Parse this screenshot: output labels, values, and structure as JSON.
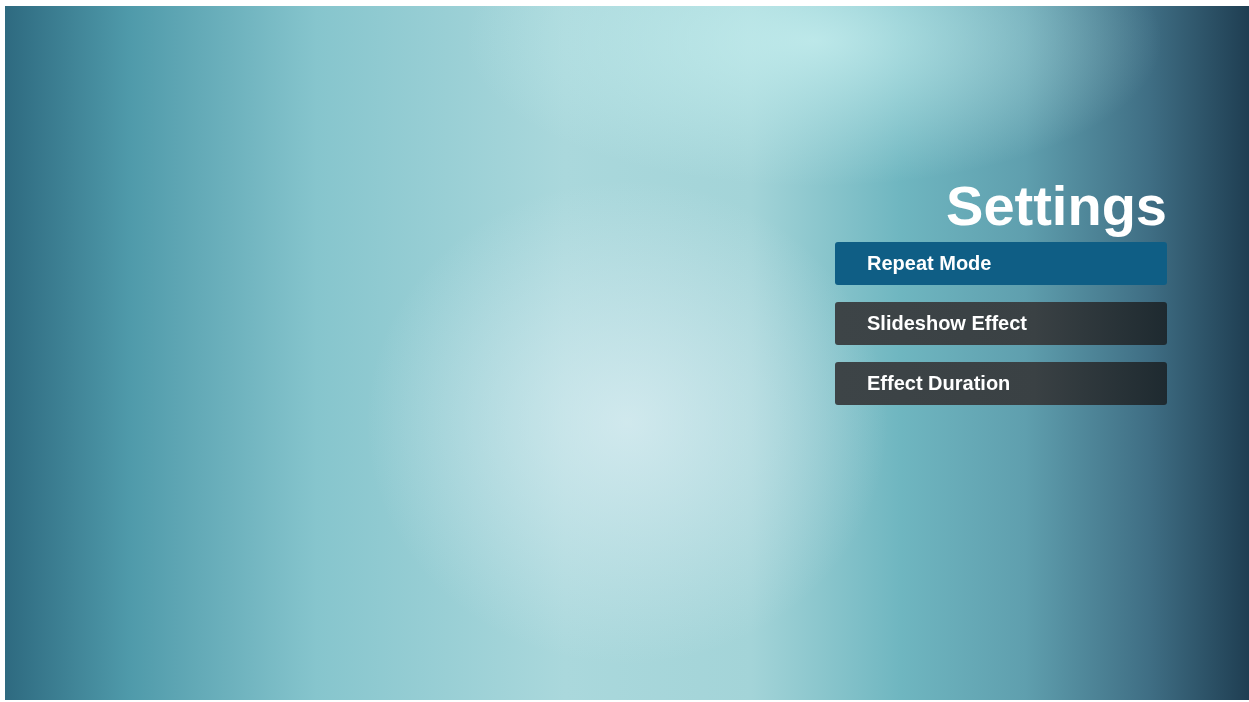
{
  "title": "Settings",
  "menu": [
    {
      "label": "Repeat Mode",
      "selected": true
    },
    {
      "label": "Slideshow Effect",
      "selected": false
    },
    {
      "label": "Effect Duration",
      "selected": false
    }
  ]
}
